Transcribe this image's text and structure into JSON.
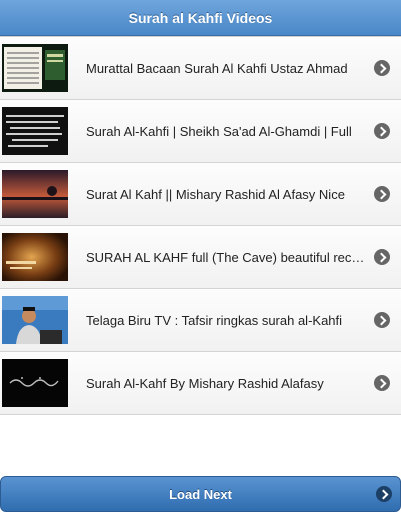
{
  "header": {
    "title": "Surah al Kahfi Videos"
  },
  "videos": [
    {
      "title": "Murattal Bacaan Surah Al Kahfi Ustaz Ahmad"
    },
    {
      "title": "Surah Al-Kahfi | Sheikh Sa'ad Al-Ghamdi | Full"
    },
    {
      "title": "Surat Al Kahf || Mishary Rashid Al Afasy Nice"
    },
    {
      "title": "SURAH AL KAHF full (The Cave) beautiful recitation"
    },
    {
      "title": "Telaga Biru TV : Tafsir ringkas surah al-Kahfi"
    },
    {
      "title": "Surah Al-Kahf By Mishary Rashid Alafasy"
    }
  ],
  "load_next": {
    "label": "Load Next"
  },
  "colors": {
    "header": "#4a87c8",
    "button": "#2f6db0"
  }
}
